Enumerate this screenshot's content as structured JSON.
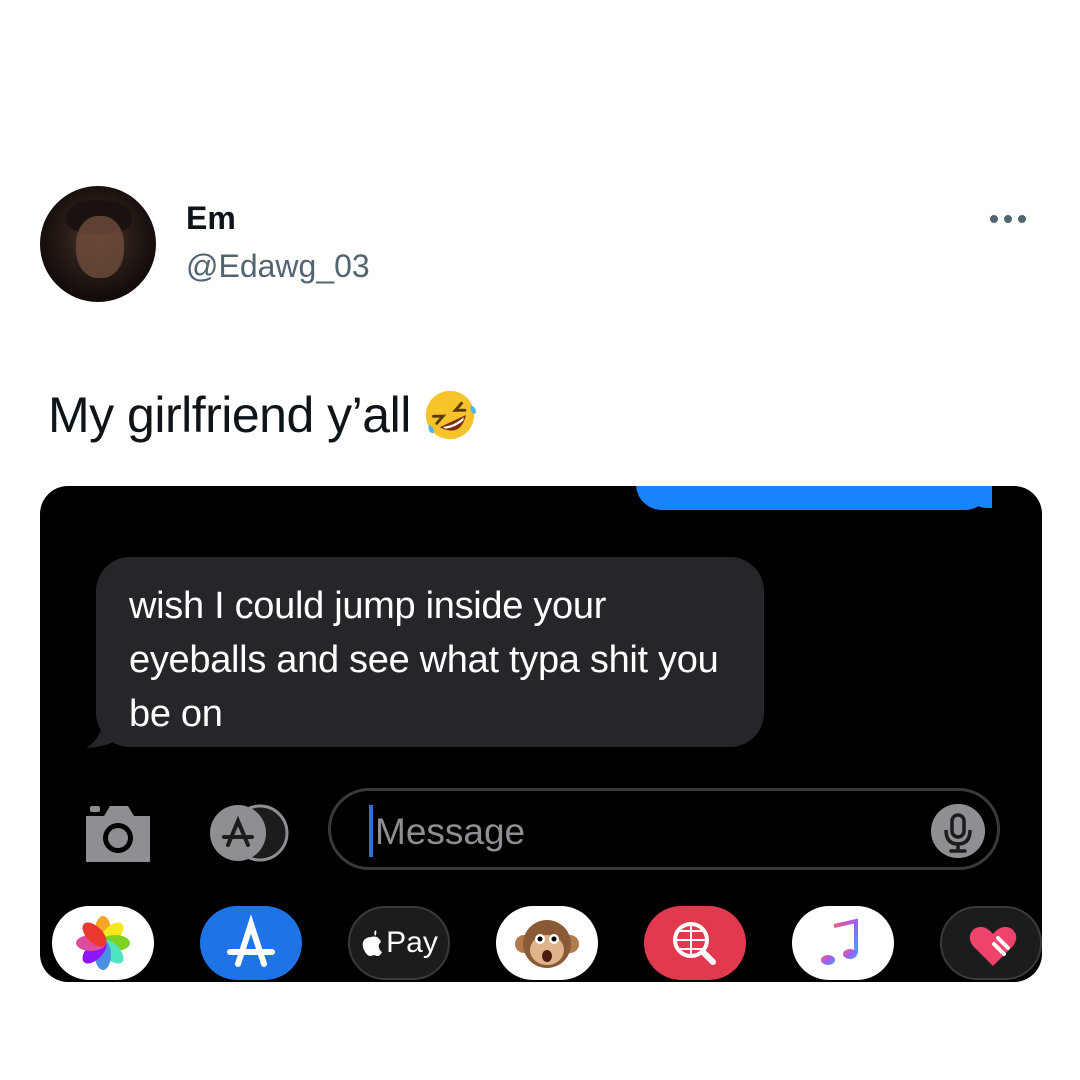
{
  "author": {
    "name": "Em",
    "handle": "@Edawg_03"
  },
  "tweet": {
    "text": "My girlfriend y’all",
    "emoji": "rolling-on-floor-laughing"
  },
  "screenshot": {
    "received_message": "wish I could jump inside your eyeballs and see what typa shit you be on",
    "input_placeholder": "Message",
    "apple_pay_label": "Pay",
    "colors": {
      "sent_bubble": "#1a82fb",
      "received_bubble": "#26252a",
      "background": "#000000"
    }
  }
}
